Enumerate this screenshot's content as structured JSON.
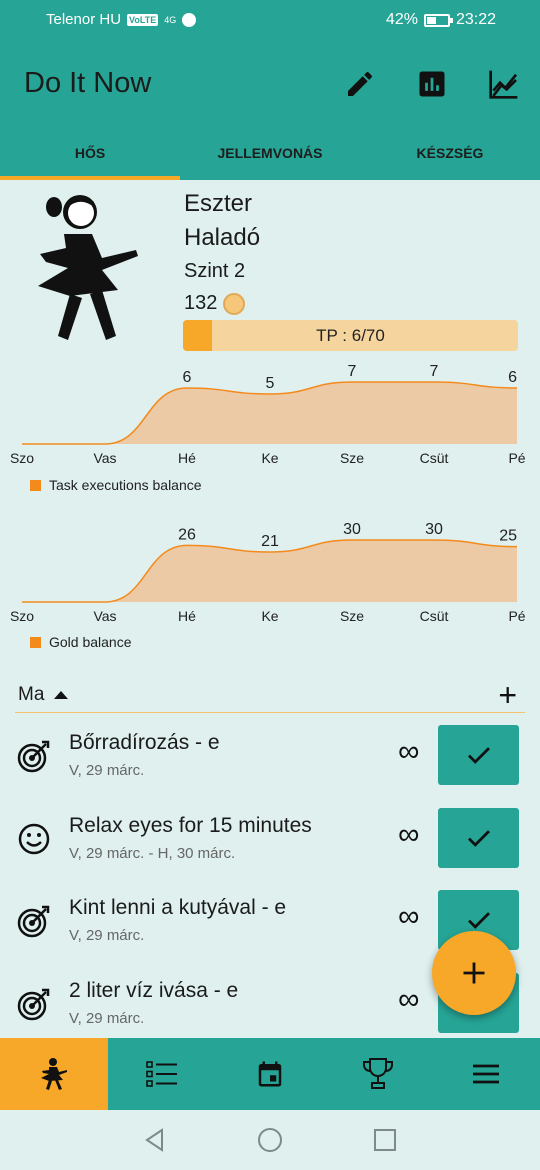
{
  "status_bar": {
    "carrier": "Telenor HU",
    "volte": "VoLTE",
    "signal": "4G",
    "battery": "42%",
    "time": "23:22"
  },
  "app": {
    "title": "Do It Now",
    "actions": [
      "edit-icon",
      "bar-chart-icon",
      "line-chart-icon"
    ]
  },
  "tabs": [
    {
      "label": "HŐS",
      "active": true
    },
    {
      "label": "JELLEMVONÁS",
      "active": false
    },
    {
      "label": "KÉSZSÉG",
      "active": false
    }
  ],
  "hero": {
    "name": "Eszter",
    "rank": "Haladó",
    "level": "Szint 2",
    "gold": "132",
    "tp_label": "TP : 6/70",
    "tp_fraction": 0.0857
  },
  "chart_data": [
    {
      "type": "area",
      "categories": [
        "Szo",
        "Vas",
        "Hé",
        "Ke",
        "Sze",
        "Csüt",
        "Pé"
      ],
      "values": [
        null,
        null,
        6,
        5,
        7,
        7,
        6
      ],
      "legend": "Task executions balance",
      "legend_position": "bottom-left",
      "grid": false,
      "color": "#f48a1c"
    },
    {
      "type": "area",
      "categories": [
        "Szo",
        "Vas",
        "Hé",
        "Ke",
        "Sze",
        "Csüt",
        "Pé"
      ],
      "values": [
        null,
        null,
        26,
        21,
        30,
        30,
        25
      ],
      "legend": "Gold balance",
      "legend_position": "bottom-left",
      "grid": false,
      "color": "#f48a1c"
    }
  ],
  "task_section": {
    "label": "Ma",
    "add_icon": "plus-icon"
  },
  "tasks": [
    {
      "title": "Bőrradírozás - e",
      "date": "V, 29 márc.",
      "icon": "target-icon",
      "repeat": "∞"
    },
    {
      "title": "Relax eyes for 15 minutes",
      "date": "V, 29 márc. - H, 30 márc.",
      "icon": "smiley-icon",
      "repeat": "∞"
    },
    {
      "title": "Kint lenni a kutyával - e",
      "date": "V, 29 márc.",
      "icon": "target-icon",
      "repeat": "∞"
    },
    {
      "title": "2 liter víz ivása - e",
      "date": "V, 29 márc.",
      "icon": "target-icon",
      "repeat": "∞"
    }
  ],
  "bottom_nav": [
    {
      "icon": "hero-icon",
      "active": true
    },
    {
      "icon": "task-list-icon",
      "active": false
    },
    {
      "icon": "calendar-icon",
      "active": false
    },
    {
      "icon": "trophy-icon",
      "active": false
    },
    {
      "icon": "menu-icon",
      "active": false
    }
  ],
  "colors": {
    "primary": "#26a596",
    "accent": "#f7a828",
    "background": "#dff0ef",
    "chart_fill": "#eccaa6",
    "chart_line": "#f48a1c"
  }
}
